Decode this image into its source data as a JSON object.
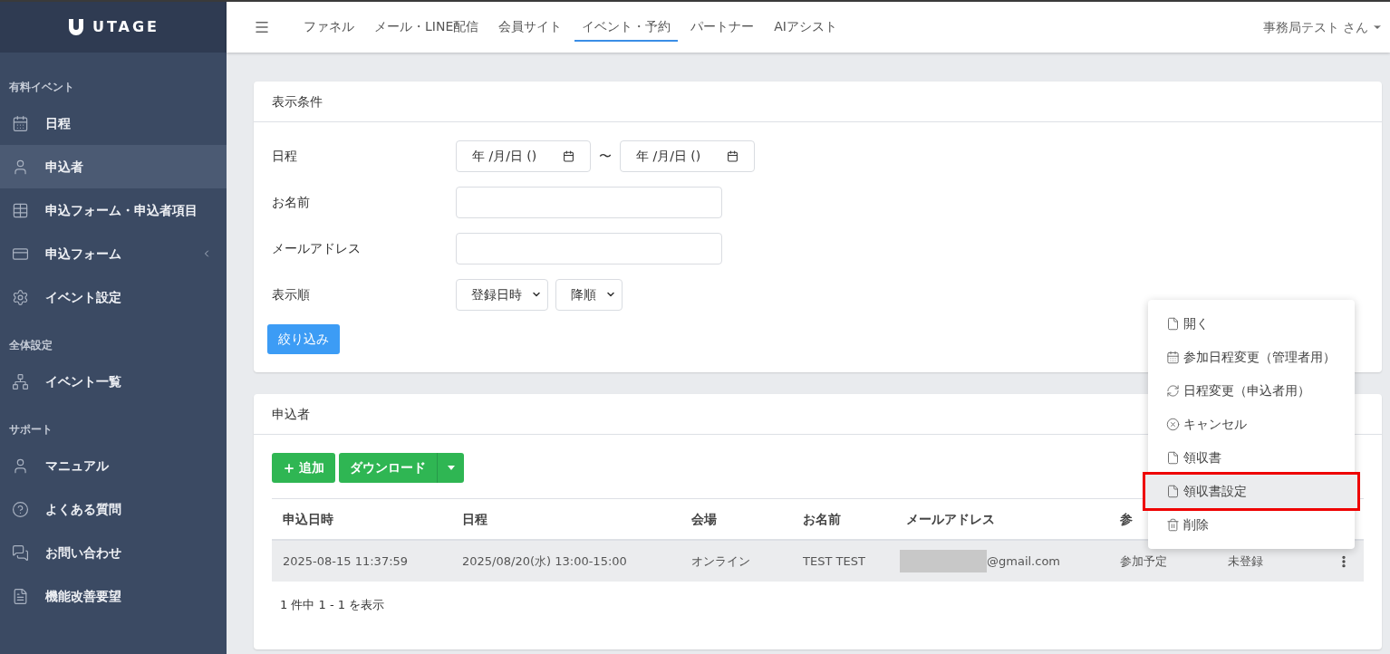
{
  "logo": {
    "text": "UTAGE"
  },
  "sidebar": {
    "sections": [
      {
        "title": "有料イベント",
        "items": [
          {
            "label": "日程",
            "selected": false,
            "has_caret": false
          },
          {
            "label": "申込者",
            "selected": true,
            "has_caret": false
          },
          {
            "label": "申込フォーム・申込者項目",
            "selected": false,
            "has_caret": false
          },
          {
            "label": "申込フォーム",
            "selected": false,
            "has_caret": true
          },
          {
            "label": "イベント設定",
            "selected": false,
            "has_caret": false
          }
        ]
      },
      {
        "title": "全体設定",
        "items": [
          {
            "label": "イベント一覧",
            "selected": false,
            "has_caret": false
          }
        ]
      },
      {
        "title": "サポート",
        "items": [
          {
            "label": "マニュアル",
            "selected": false,
            "has_caret": false
          },
          {
            "label": "よくある質問",
            "selected": false,
            "has_caret": false
          },
          {
            "label": "お問い合わせ",
            "selected": false,
            "has_caret": false
          },
          {
            "label": "機能改善要望",
            "selected": false,
            "has_caret": false
          }
        ]
      }
    ]
  },
  "topnav": {
    "tabs": [
      {
        "label": "ファネル",
        "selected": false
      },
      {
        "label": "メール・LINE配信",
        "selected": false
      },
      {
        "label": "会員サイト",
        "selected": false
      },
      {
        "label": "イベント・予約",
        "selected": true
      },
      {
        "label": "パートナー",
        "selected": false
      },
      {
        "label": "AIアシスト",
        "selected": false
      }
    ],
    "user": "事務局テスト さん"
  },
  "filter": {
    "title": "表示条件",
    "date_label": "日程",
    "date_from": "年 /月/日 ()",
    "separator": "〜",
    "date_to": "年 /月/日 ()",
    "name_label": "お名前",
    "email_label": "メールアドレス",
    "order_label": "表示順",
    "order_by": "登録日時",
    "order_dir": "降順",
    "submit": "絞り込み"
  },
  "applicants": {
    "title": "申込者",
    "add_button": "追加",
    "download_button": "ダウンロード",
    "columns": [
      "申込日時",
      "日程",
      "会場",
      "お名前",
      "メールアドレス",
      "参"
    ],
    "rows": [
      {
        "cells": [
          "2025-08-15 11:37:59",
          "2025/08/20(水) 13:00-15:00",
          "オンライン",
          "TEST TEST",
          "@gmail.com",
          "参加予定",
          "未登録"
        ]
      }
    ],
    "summary": "1 件中 1 - 1 を表示"
  },
  "context_menu": {
    "items": [
      {
        "label": "開く",
        "highlighted": false
      },
      {
        "label": "参加日程変更（管理者用）",
        "highlighted": false
      },
      {
        "label": "日程変更（申込者用）",
        "highlighted": false
      },
      {
        "label": "キャンセル",
        "highlighted": false
      },
      {
        "label": "領収書",
        "highlighted": false
      },
      {
        "label": "領収書設定",
        "highlighted": true
      },
      {
        "label": "削除",
        "highlighted": false
      }
    ]
  }
}
